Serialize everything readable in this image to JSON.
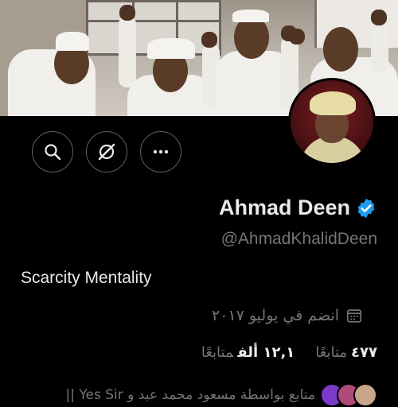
{
  "profile": {
    "display_name": "Ahmad Deen",
    "handle": "@AhmadKhalidDeen",
    "bio": "Scarcity Mentality",
    "joined": "انضم في يوليو ٢٠١٧",
    "verified": true
  },
  "stats": {
    "following_count": "٤٧٧",
    "following_label": "متابعًا",
    "followers_count": "١٢,١ ألف",
    "followers_label": "متابعًا"
  },
  "followed_by": {
    "text": "متابع بواسطة مسعود محمد عبد و Yes Sir ||"
  },
  "actions": {
    "search_icon": "search-icon",
    "grok_icon": "grok-icon",
    "more_icon": "more-icon"
  },
  "colors": {
    "background": "#000000",
    "primary_text": "#e7e9ea",
    "secondary_text": "#71767b",
    "verified_blue": "#1d9bf0",
    "button_border": "#536471"
  }
}
